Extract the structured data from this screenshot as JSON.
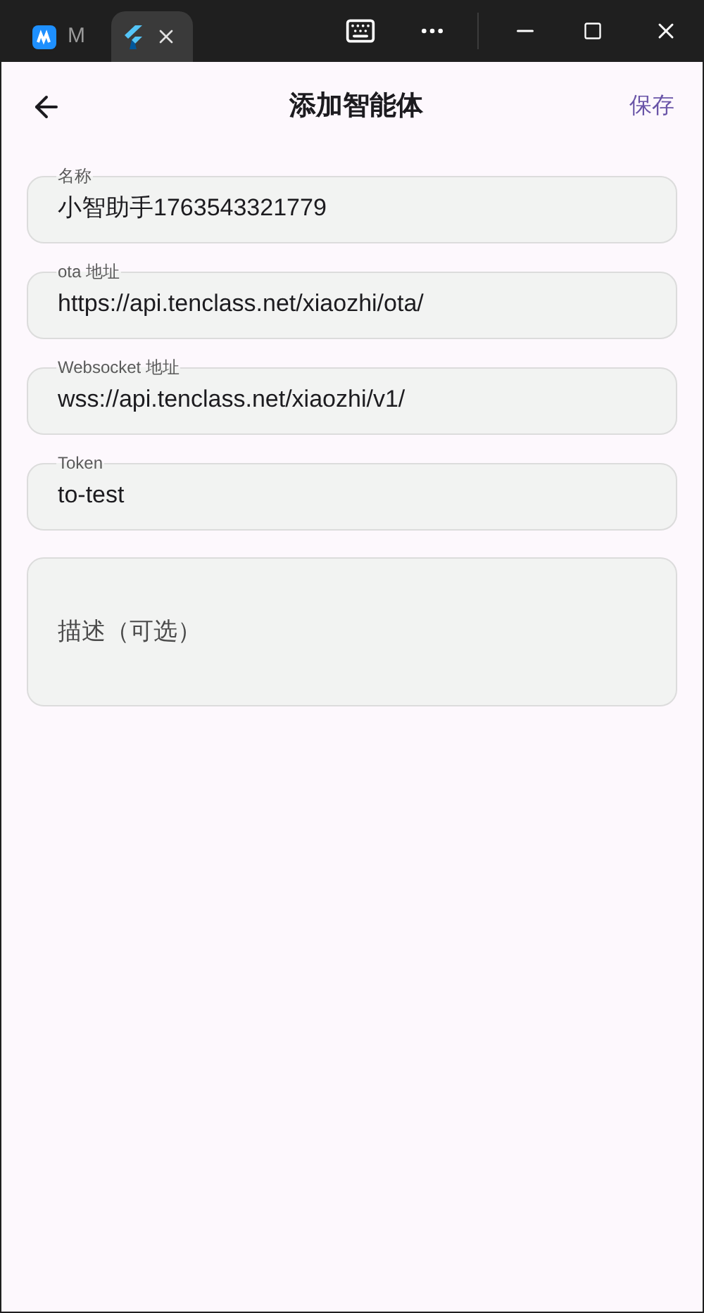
{
  "tabs": [
    {
      "label": "M",
      "selected": false
    },
    {
      "selected": true
    }
  ],
  "header": {
    "title": "添加智能体",
    "action": "保存"
  },
  "fields": [
    {
      "label": "名称",
      "value": "小智助手1763543321779"
    },
    {
      "label": "ota 地址",
      "value": "https://api.tenclass.net/xiaozhi/ota/"
    },
    {
      "label": "Websocket 地址",
      "value": "wss://api.tenclass.net/xiaozhi/v1/"
    },
    {
      "label": "Token",
      "value": "to-test"
    }
  ],
  "description": {
    "placeholder": "描述（可选）"
  }
}
